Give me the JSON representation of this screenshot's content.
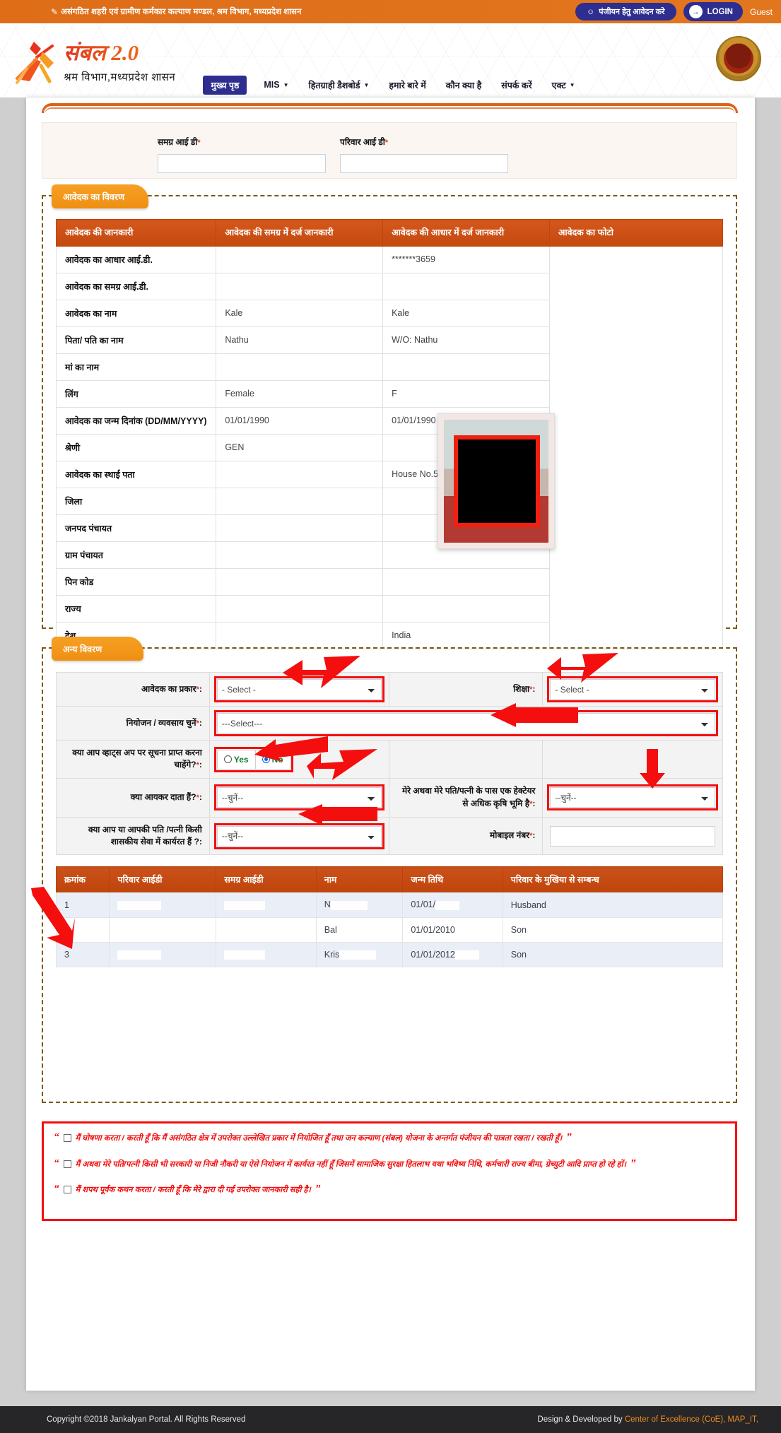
{
  "topbar": {
    "pen_icon": "pencil-icon",
    "title": "असंगठित शहरी एवं ग्रामीण कर्मकार कल्याण मण्डल, श्रम विभाग, मध्यप्रदेश शासन",
    "register_label": "पंजीयन हेतु आवेदन करे",
    "register_icon": "user-plus-icon",
    "login_label": "LOGIN",
    "login_icon": "login-arrow-icon",
    "guest_label": "Guest"
  },
  "header": {
    "brand_title": "संबल 2.0",
    "brand_sub": "श्रम विभाग,मध्यप्रदेश शासन",
    "emblem_name": "mp-government-emblem"
  },
  "nav": {
    "items": [
      {
        "label": "मुख्य पृष्ठ",
        "active": true,
        "has_caret": false
      },
      {
        "label": "MIS",
        "active": false,
        "has_caret": true
      },
      {
        "label": "हितग्राही डैशबोर्ड",
        "active": false,
        "has_caret": true
      },
      {
        "label": "हमारे बारे में",
        "active": false,
        "has_caret": false
      },
      {
        "label": "कौन क्या है",
        "active": false,
        "has_caret": false
      },
      {
        "label": "संपर्क करें",
        "active": false,
        "has_caret": false
      },
      {
        "label": "एक्ट",
        "active": false,
        "has_caret": true
      }
    ]
  },
  "id_panel": {
    "samagra_label": "समग्र आई डी",
    "samagra_value": "",
    "parivar_label": "परिवार आई डी",
    "parivar_value": "",
    "required_mark": "*"
  },
  "applicant_section": {
    "title": "आवेदक का विवरण",
    "headers": [
      "आवेदक की जानकारी",
      "आवेदक की समग्र में दर्ज जानकारी",
      "आवेदक की आधार में दर्ज जानकारी",
      "आवेदक का फोटो"
    ],
    "rows": [
      {
        "label": "आवेदक का आधार आई.डी.",
        "samagra": "",
        "aadhaar": "*******3659"
      },
      {
        "label": "आवेदक का समग्र आई.डी.",
        "samagra": "",
        "aadhaar": ""
      },
      {
        "label": "आवेदक का नाम",
        "samagra": "Kale",
        "aadhaar": "Kale"
      },
      {
        "label": "पिता/ पति का नाम",
        "samagra": "Nathu",
        "aadhaar": "W/O: Nathu"
      },
      {
        "label": "मां का नाम",
        "samagra": "",
        "aadhaar": ""
      },
      {
        "label": "लिंग",
        "samagra": "Female",
        "aadhaar": "F"
      },
      {
        "label": "आवेदक का जन्म दिनांक (DD/MM/YYYY)",
        "samagra": "01/01/1990",
        "aadhaar": "01/01/1990"
      },
      {
        "label": "श्रेणी",
        "samagra": "GEN",
        "aadhaar": ""
      },
      {
        "label": "आवेदक का स्थाई पता",
        "samagra": "",
        "aadhaar": "House No.57/2"
      },
      {
        "label": "जिला",
        "samagra": "",
        "aadhaar": ""
      },
      {
        "label": "जनपद पंचायत",
        "samagra": "",
        "aadhaar": ""
      },
      {
        "label": "ग्राम पंचायत",
        "samagra": "",
        "aadhaar": ""
      },
      {
        "label": "पिन कोड",
        "samagra": "",
        "aadhaar": ""
      },
      {
        "label": "राज्य",
        "samagra": "",
        "aadhaar": ""
      },
      {
        "label": "देश",
        "samagra": "",
        "aadhaar": "India"
      }
    ],
    "photo_name": "applicant-photo"
  },
  "other_section": {
    "title": "अन्य विवरण",
    "applicant_type_label": "आवेदक का प्रकार",
    "applicant_type_value": "- Select -",
    "education_label": "शिक्षा",
    "education_value": "- Select -",
    "occupation_label": "नियोजन / व्यवसाय चुनें",
    "occupation_value": "---Select---",
    "whatsapp_label": "क्या आप व्हाट्स अप पर सूचना प्राप्त करना चाहेंगे?",
    "whatsapp_yes": "Yes",
    "whatsapp_no": "No",
    "whatsapp_selected": "No",
    "income_tax_label": "क्या आयकर दाता हैं?",
    "income_tax_value": "--चुनें--",
    "land_label": "मेरे अथवा मेरे पति/पत्नी के पास एक हेक्टेयर से अधिक कृषि भूमि है",
    "land_value": "--चुनें--",
    "govt_service_label": "क्या आप या आपकी पति /पत्नी किसी शासकीय सेवा में कार्यरत हैं ?",
    "govt_service_value": "--चुनें--",
    "mobile_label": "मोबाइल नंबर",
    "mobile_value": "",
    "required_mark": "*"
  },
  "family_table": {
    "headers": [
      "क्रमांक",
      "परिवार आईडी",
      "समग्र आईडी",
      "नाम",
      "जन्म तिथि",
      "परिवार के मुखिया से सम्बन्ध"
    ],
    "rows": [
      {
        "sr": "1",
        "family_id": "",
        "samagra_id": "",
        "name": "N",
        "dob": "01/01/",
        "relation": "Husband"
      },
      {
        "sr": "2",
        "family_id": "",
        "samagra_id": "",
        "name": "Bal",
        "dob": "01/01/2010",
        "relation": "Son"
      },
      {
        "sr": "3",
        "family_id": "",
        "samagra_id": "",
        "name": "Kris",
        "dob": "01/01/2012",
        "relation": "Son"
      }
    ]
  },
  "declarations": {
    "open_quote": "“",
    "close_quote": "”",
    "items": [
      "मैं घोषणा करता / करती हूँ कि मैं असंगठित क्षेत्र में उपरोक्त उल्लेखित प्रकार में नियोजित हूँ तथा जन कल्याण (संबल) योजना के अन्तर्गत पंजीयन की पात्रता रखता / रखती हूँ।",
      "मैं अथवा मेरे पति/पत्नी किसी भी सरकारी या निजी नौकरी या ऐसे नियोजन में कार्यरत नहीं हूँ जिसमें सामाजिक सुरक्षा हितलाभ यथा भविष्य निधि, कर्मचारी राज्य बीमा, ग्रेच्युटी आदि प्राप्त हो रहे हों।",
      "मैं शपथ पूर्वक कथन करता / करती हूँ कि मेरे द्वारा दी गई उपरोक्त जानकारी सही है।"
    ]
  },
  "footer": {
    "copyright": "Copyright ©2018 Jankalyan Portal. All Rights Reserved",
    "developed_prefix": "Design & Developed by ",
    "developed_link": "Center of Excellence (CoE), MAP_IT,"
  },
  "colors": {
    "orange_bar": "#e2711d",
    "brand_blue": "#2d2e8f",
    "table_header": "#c4490f",
    "pill": "#ef8f12",
    "highlight_red": "#f40e0e",
    "footer_bg": "#262629"
  }
}
